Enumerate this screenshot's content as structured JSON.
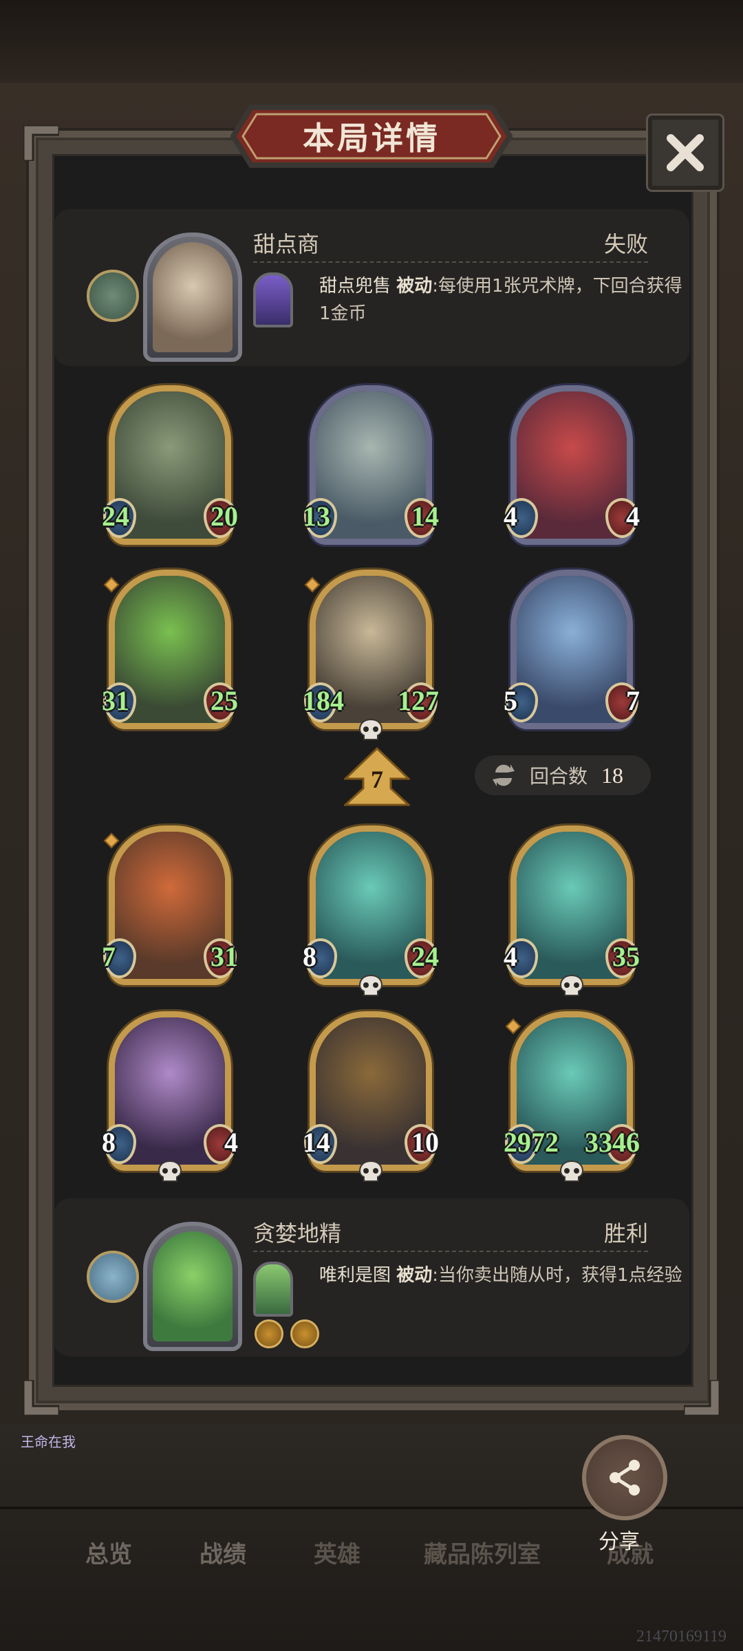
{
  "title": "本局详情",
  "players": {
    "top": {
      "name": "甜点商",
      "result": "失败",
      "power_name": "甜点兜售",
      "power_type": "被动",
      "power_desc": ":每使用1张咒术牌，下回合获得1金币"
    },
    "bottom": {
      "name": "贪婪地精",
      "result": "胜利",
      "power_name": "唯利是图",
      "power_type": "被动",
      "power_desc": ":当你卖出随从时，获得1点经验"
    }
  },
  "enemy_minions": [
    {
      "atk": "24",
      "hp": "20",
      "frame": "gold",
      "buffed": true
    },
    {
      "atk": "13",
      "hp": "14",
      "frame": "silver",
      "buffed": true
    },
    {
      "atk": "4",
      "hp": "4",
      "frame": "silver",
      "buffed": false
    },
    {
      "atk": "31",
      "hp": "25",
      "frame": "gold",
      "buffed": true
    },
    {
      "atk": "184",
      "hp": "127",
      "frame": "gold",
      "buffed": true
    },
    {
      "atk": "5",
      "hp": "7",
      "frame": "silver",
      "buffed": false
    }
  ],
  "tier": "7",
  "round": {
    "label": "回合数",
    "value": "18"
  },
  "player_minions": [
    {
      "atk": "7",
      "hp": "31",
      "buffed_atk": true,
      "buffed_hp": true
    },
    {
      "atk": "8",
      "hp": "24",
      "buffed_atk": false,
      "buffed_hp": true
    },
    {
      "atk": "4",
      "hp": "35",
      "buffed_atk": false,
      "buffed_hp": true
    },
    {
      "atk": "8",
      "hp": "4",
      "buffed_atk": false,
      "buffed_hp": false
    },
    {
      "atk": "14",
      "hp": "10",
      "buffed_atk": false,
      "buffed_hp": false
    },
    {
      "atk": "2972",
      "hp": "3346",
      "buffed_atk": true,
      "buffed_hp": true
    }
  ],
  "share_label": "分享",
  "nav": [
    "总览",
    "战绩",
    "英雄",
    "藏品陈列室",
    "成就"
  ],
  "chat_preview": "王命在我",
  "footer_id": "21470169119",
  "colors": {
    "gold_frame": "#c49a4c",
    "silver_frame": "#6a6c8a",
    "buff_green": "#a6f08e"
  }
}
